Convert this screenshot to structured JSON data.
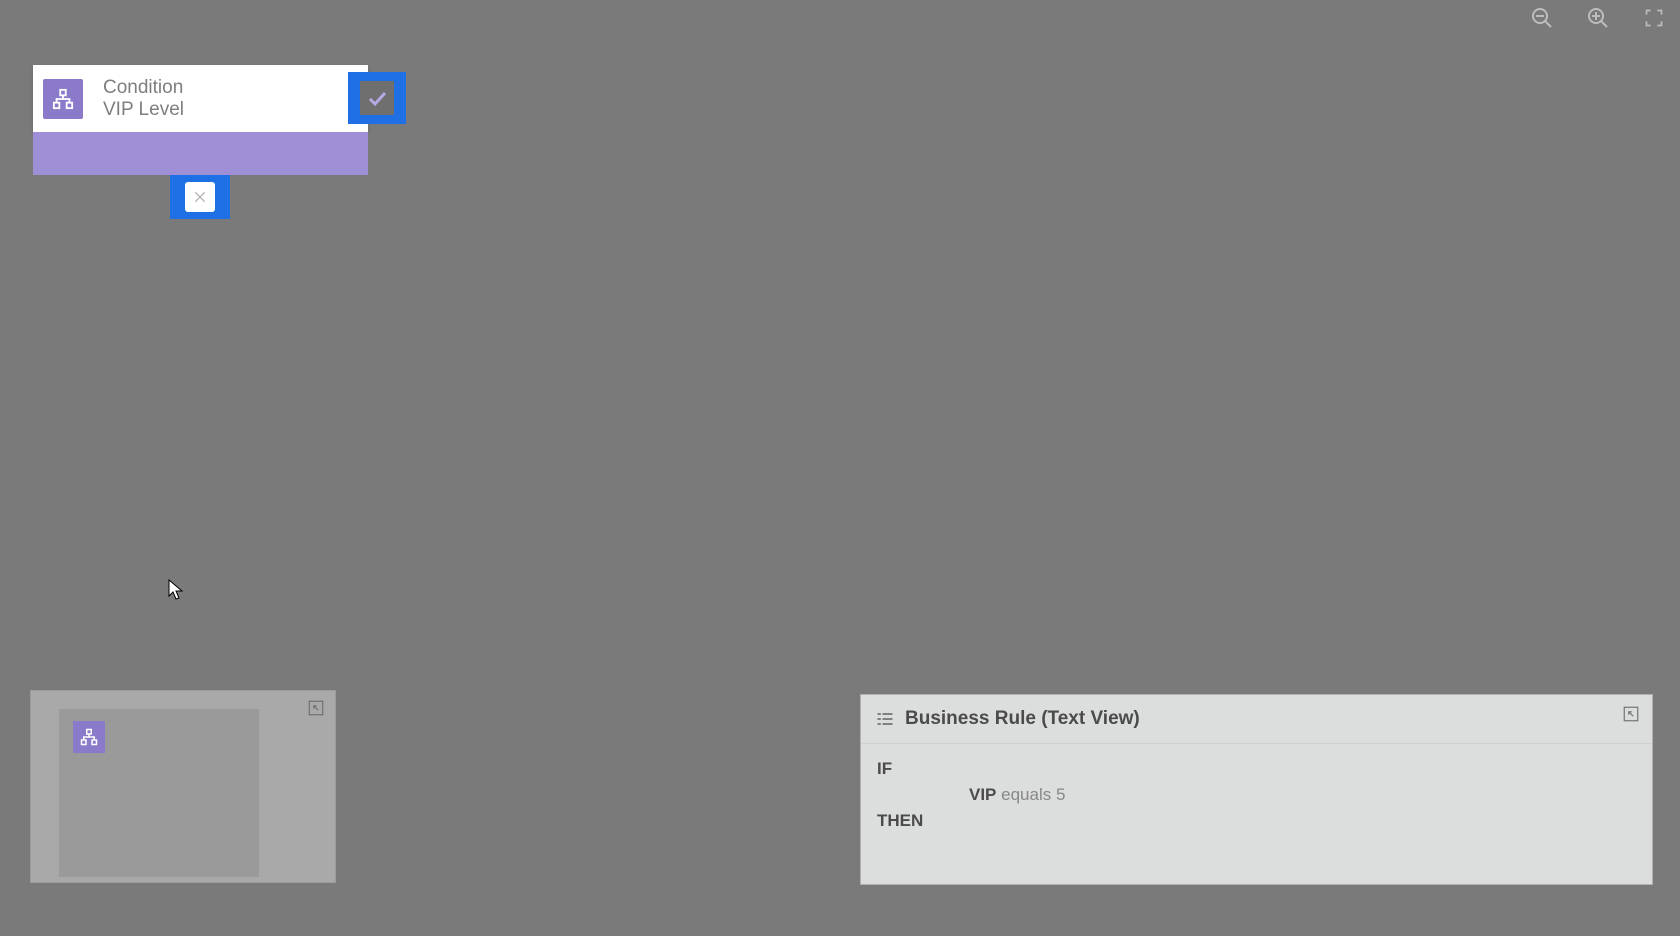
{
  "toolbar": {
    "zoom_out_name": "zoom-out",
    "zoom_in_name": "zoom-in",
    "fit_name": "fit-to-screen"
  },
  "condition_node": {
    "type_label": "Condition",
    "name_label": "VIP Level",
    "accent_color": "#8b79c9",
    "yes_port_color": "#1f6fe5",
    "no_port_color": "#1f6fe5"
  },
  "text_view": {
    "title": "Business Rule (Text View)",
    "if_keyword": "IF",
    "then_keyword": "THEN",
    "expression_field": "VIP",
    "expression_rest": "equals 5"
  }
}
